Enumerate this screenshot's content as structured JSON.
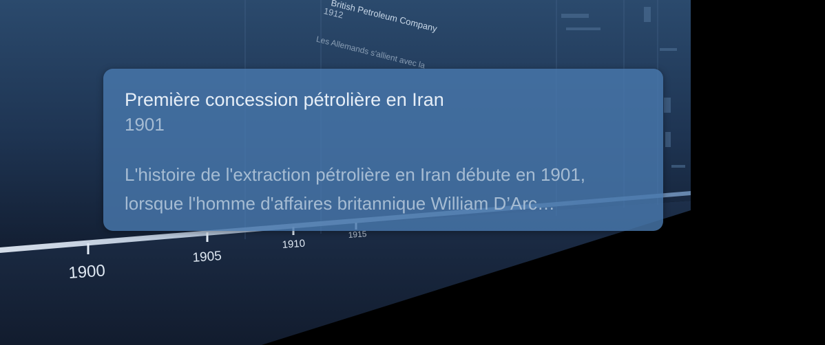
{
  "timeline": {
    "ticks": [
      "1900",
      "1905",
      "1910",
      "1915"
    ],
    "background_snippets": {
      "event_title": "British Petroleum Company",
      "event_year": "1912",
      "event_text": "Les Allemands s'allient avec la"
    }
  },
  "popup": {
    "title": "Première concession pétrolière en Iran",
    "year": "1901",
    "text_line1": "L'histoire de l'extraction pétrolière en Iran débute en 1901,",
    "text_line2": "lorsque l'homme d'affaires britannique William D’Arc…"
  },
  "colors": {
    "background": "#000000",
    "panel_top": "#2a4a6e",
    "panel_bottom": "#14233b",
    "popup": "#4878ac",
    "popup_title": "#e6eef7",
    "popup_text": "#a6bcd3"
  }
}
